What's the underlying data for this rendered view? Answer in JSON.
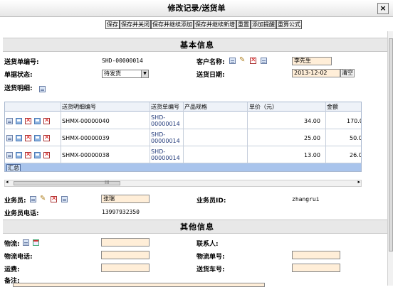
{
  "window": {
    "title": "修改记录/送货单",
    "close_glyph": "×"
  },
  "toolbar": [
    "保存",
    "保存并关闭",
    "保存并继续添加",
    "保存并继续新增",
    "重置",
    "添加提醒",
    "重算公式"
  ],
  "sections": {
    "basic": "基本信息",
    "other": "其他信息"
  },
  "basic": {
    "order_no_label": "送货单编号:",
    "order_no": "SHD-00000014",
    "customer_label": "客户名称:",
    "customer": "李先生",
    "status_label": "单据状态:",
    "status": "待发货",
    "date_label": "送货日期:",
    "date": "2013-12-02",
    "date_button": "清空",
    "detail_label": "送货明细:"
  },
  "grid": {
    "columns": [
      "送货明细编号",
      "送货单编号",
      "产品规格",
      "单价（元）",
      "金额"
    ],
    "rows": [
      {
        "detail_no": "SHMX-00000040",
        "order_no": "SHD-00000014",
        "spec": "",
        "price": "34.00",
        "amount": "170.0"
      },
      {
        "detail_no": "SHMX-00000039",
        "order_no": "SHD-00000014",
        "spec": "",
        "price": "25.00",
        "amount": "50.0"
      },
      {
        "detail_no": "SHMX-00000038",
        "order_no": "SHD-00000014",
        "spec": "",
        "price": "13.00",
        "amount": "26.0"
      }
    ],
    "summary": "汇总",
    "scroll_grip": "III"
  },
  "sales": {
    "salesman_label": "业务员:",
    "salesman": "张瑞",
    "salesman_id_label": "业务员ID:",
    "salesman_id": "zhangrui",
    "phone_label": "业务员电话:",
    "phone": "13997932350"
  },
  "other": {
    "logistics_label": "物流:",
    "contact_label": "联系人:",
    "logistics_phone_label": "物流电话:",
    "logistics_no_label": "物流单号:",
    "freight_label": "运费:",
    "vehicle_label": "送货车号:",
    "remark_label": "备注:"
  }
}
